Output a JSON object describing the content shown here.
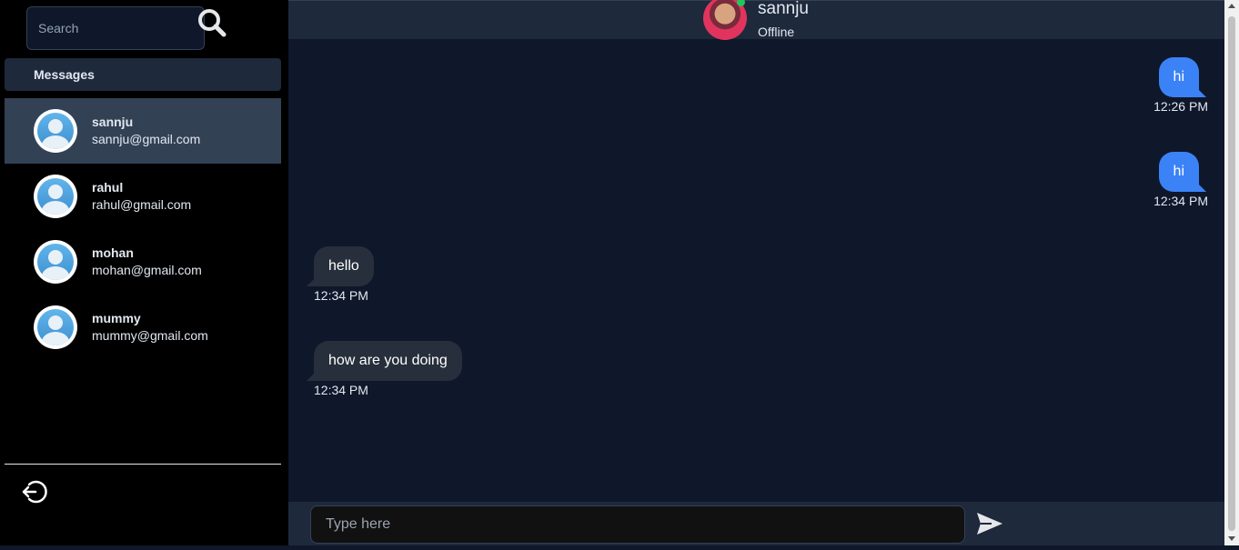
{
  "search": {
    "placeholder": "Search"
  },
  "sidebar": {
    "header": "Messages",
    "contacts": [
      {
        "name": "sannju",
        "email": "sannju@gmail.com",
        "active": true
      },
      {
        "name": "rahul",
        "email": "rahul@gmail.com",
        "active": false
      },
      {
        "name": "mohan",
        "email": "mohan@gmail.com",
        "active": false
      },
      {
        "name": "mummy",
        "email": "mummy@gmail.com",
        "active": false
      }
    ]
  },
  "chat": {
    "contact_name": "sannju",
    "status": "Offline",
    "messages": [
      {
        "text": "hi",
        "time": "12:26 PM",
        "from": "me"
      },
      {
        "text": "hi",
        "time": "12:34 PM",
        "from": "me"
      },
      {
        "text": "hello",
        "time": "12:34 PM",
        "from": "other"
      },
      {
        "text": "how are you doing",
        "time": "12:34 PM",
        "from": "other"
      }
    ],
    "input_placeholder": "Type here"
  },
  "colors": {
    "sent_bubble": "#3b82f6",
    "received_bubble": "#262f3b",
    "background": "#0f172a",
    "sidebar_bg": "#000000",
    "active_contact": "#334155",
    "online_dot": "#22c55e"
  },
  "icons": {
    "search": "search-icon",
    "logout": "logout-icon",
    "send": "send-icon"
  }
}
